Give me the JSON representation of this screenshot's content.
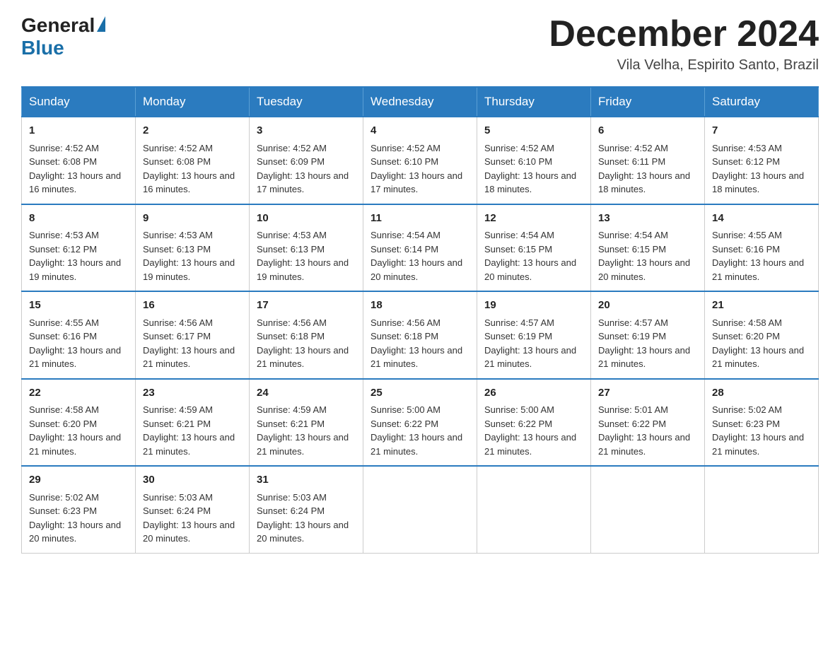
{
  "header": {
    "logo_general": "General",
    "logo_blue": "Blue",
    "title": "December 2024",
    "location": "Vila Velha, Espirito Santo, Brazil"
  },
  "columns": [
    "Sunday",
    "Monday",
    "Tuesday",
    "Wednesday",
    "Thursday",
    "Friday",
    "Saturday"
  ],
  "weeks": [
    [
      {
        "day": "1",
        "sunrise": "4:52 AM",
        "sunset": "6:08 PM",
        "daylight": "13 hours and 16 minutes."
      },
      {
        "day": "2",
        "sunrise": "4:52 AM",
        "sunset": "6:08 PM",
        "daylight": "13 hours and 16 minutes."
      },
      {
        "day": "3",
        "sunrise": "4:52 AM",
        "sunset": "6:09 PM",
        "daylight": "13 hours and 17 minutes."
      },
      {
        "day": "4",
        "sunrise": "4:52 AM",
        "sunset": "6:10 PM",
        "daylight": "13 hours and 17 minutes."
      },
      {
        "day": "5",
        "sunrise": "4:52 AM",
        "sunset": "6:10 PM",
        "daylight": "13 hours and 18 minutes."
      },
      {
        "day": "6",
        "sunrise": "4:52 AM",
        "sunset": "6:11 PM",
        "daylight": "13 hours and 18 minutes."
      },
      {
        "day": "7",
        "sunrise": "4:53 AM",
        "sunset": "6:12 PM",
        "daylight": "13 hours and 18 minutes."
      }
    ],
    [
      {
        "day": "8",
        "sunrise": "4:53 AM",
        "sunset": "6:12 PM",
        "daylight": "13 hours and 19 minutes."
      },
      {
        "day": "9",
        "sunrise": "4:53 AM",
        "sunset": "6:13 PM",
        "daylight": "13 hours and 19 minutes."
      },
      {
        "day": "10",
        "sunrise": "4:53 AM",
        "sunset": "6:13 PM",
        "daylight": "13 hours and 19 minutes."
      },
      {
        "day": "11",
        "sunrise": "4:54 AM",
        "sunset": "6:14 PM",
        "daylight": "13 hours and 20 minutes."
      },
      {
        "day": "12",
        "sunrise": "4:54 AM",
        "sunset": "6:15 PM",
        "daylight": "13 hours and 20 minutes."
      },
      {
        "day": "13",
        "sunrise": "4:54 AM",
        "sunset": "6:15 PM",
        "daylight": "13 hours and 20 minutes."
      },
      {
        "day": "14",
        "sunrise": "4:55 AM",
        "sunset": "6:16 PM",
        "daylight": "13 hours and 21 minutes."
      }
    ],
    [
      {
        "day": "15",
        "sunrise": "4:55 AM",
        "sunset": "6:16 PM",
        "daylight": "13 hours and 21 minutes."
      },
      {
        "day": "16",
        "sunrise": "4:56 AM",
        "sunset": "6:17 PM",
        "daylight": "13 hours and 21 minutes."
      },
      {
        "day": "17",
        "sunrise": "4:56 AM",
        "sunset": "6:18 PM",
        "daylight": "13 hours and 21 minutes."
      },
      {
        "day": "18",
        "sunrise": "4:56 AM",
        "sunset": "6:18 PM",
        "daylight": "13 hours and 21 minutes."
      },
      {
        "day": "19",
        "sunrise": "4:57 AM",
        "sunset": "6:19 PM",
        "daylight": "13 hours and 21 minutes."
      },
      {
        "day": "20",
        "sunrise": "4:57 AM",
        "sunset": "6:19 PM",
        "daylight": "13 hours and 21 minutes."
      },
      {
        "day": "21",
        "sunrise": "4:58 AM",
        "sunset": "6:20 PM",
        "daylight": "13 hours and 21 minutes."
      }
    ],
    [
      {
        "day": "22",
        "sunrise": "4:58 AM",
        "sunset": "6:20 PM",
        "daylight": "13 hours and 21 minutes."
      },
      {
        "day": "23",
        "sunrise": "4:59 AM",
        "sunset": "6:21 PM",
        "daylight": "13 hours and 21 minutes."
      },
      {
        "day": "24",
        "sunrise": "4:59 AM",
        "sunset": "6:21 PM",
        "daylight": "13 hours and 21 minutes."
      },
      {
        "day": "25",
        "sunrise": "5:00 AM",
        "sunset": "6:22 PM",
        "daylight": "13 hours and 21 minutes."
      },
      {
        "day": "26",
        "sunrise": "5:00 AM",
        "sunset": "6:22 PM",
        "daylight": "13 hours and 21 minutes."
      },
      {
        "day": "27",
        "sunrise": "5:01 AM",
        "sunset": "6:22 PM",
        "daylight": "13 hours and 21 minutes."
      },
      {
        "day": "28",
        "sunrise": "5:02 AM",
        "sunset": "6:23 PM",
        "daylight": "13 hours and 21 minutes."
      }
    ],
    [
      {
        "day": "29",
        "sunrise": "5:02 AM",
        "sunset": "6:23 PM",
        "daylight": "13 hours and 20 minutes."
      },
      {
        "day": "30",
        "sunrise": "5:03 AM",
        "sunset": "6:24 PM",
        "daylight": "13 hours and 20 minutes."
      },
      {
        "day": "31",
        "sunrise": "5:03 AM",
        "sunset": "6:24 PM",
        "daylight": "13 hours and 20 minutes."
      },
      null,
      null,
      null,
      null
    ]
  ],
  "labels": {
    "sunrise": "Sunrise:",
    "sunset": "Sunset:",
    "daylight": "Daylight:"
  }
}
